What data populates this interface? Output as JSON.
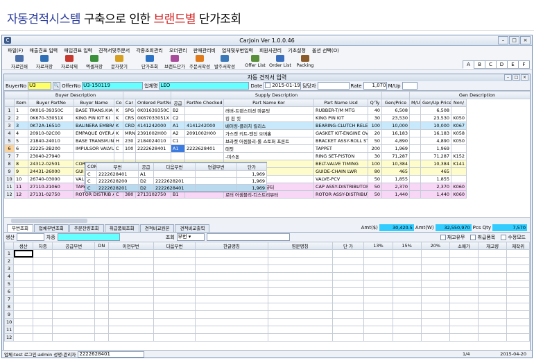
{
  "header": {
    "part1": "자동견적시스템",
    "part2": " 구축으로 인한 ",
    "part3": "브랜드별",
    "part4": " 단가조회"
  },
  "window": {
    "title": "CarJoin Ver 1.0.0.46"
  },
  "menu": [
    "파일(F)",
    "매출견표 입력",
    "매입견표 입력",
    "견적서및주문서",
    "각종조회관리",
    "오더관리",
    "판매관리비",
    "업체및부번입력",
    "회원사관리",
    "기초설정",
    "옵션 선택(O)"
  ],
  "toolbar": [
    "자료인쇄",
    "자료저장",
    "자료삭제",
    "엑셀저장",
    "문자찾기",
    "단가조회",
    "브랜드단가",
    "주문서작성",
    "발주서작성",
    "Offer List",
    "Order List",
    "Packing"
  ],
  "alpha_tabs": [
    "A",
    "B",
    "C",
    "D",
    "E",
    "F"
  ],
  "subwindow": {
    "title": "자동 견적서 입력"
  },
  "form": {
    "buyerno_label": "BuyerNo",
    "buyerno": "U3",
    "offerno_label": "OfferNo",
    "offerno": "U3-150119",
    "company_label": "업체명",
    "company": "LEO",
    "date_label": "Date",
    "date": "2015-01-19",
    "manager_label": "담당자",
    "rate_label": "Rate",
    "rate": "1,070",
    "unit": "M/Up"
  },
  "grid1": {
    "group_headers": {
      "buyer": "Buyer Description",
      "supply": "Supply Description",
      "gen": "Gen Description"
    },
    "columns": [
      "Item",
      "Buyer PartNo",
      "Buyer Name",
      "Co",
      "Car",
      "Ordered PartNo",
      "공급",
      "PartNo Checked",
      "Part Name Kor",
      "Part Name Usd",
      "Q'Ty",
      "Gen/Price",
      "M/Up",
      "Gen/Up Price",
      "Non/"
    ],
    "rows": [
      [
        "1",
        "1",
        "0K016-39350C",
        "BASE TRANS.KIA",
        "K",
        "SPG",
        "0K01639350C",
        "B2",
        "",
        "러버-트랜스미션 마운팅",
        "RUBBER-T/M MTG",
        "40",
        "6,508",
        "",
        "6,508",
        ""
      ],
      [
        "2",
        "2",
        "0K670-33051X",
        "KING PIN KIT KI",
        "K",
        "CRS",
        "0K67033051X",
        "C2",
        "",
        "킹 핀 킷",
        "KING PIN KIT",
        "30",
        "23,530",
        "",
        "23,530",
        "K050"
      ],
      [
        "3",
        "3",
        "0K72A-16510",
        "BALINERA EMBRAG",
        "K",
        "CRD",
        "4141242000",
        "A1",
        "4141242000",
        "베어링-클러치 릴리스",
        "BEARING-CLUTCH RELEASE",
        "100",
        "10,000",
        "",
        "10,000",
        "K067"
      ],
      [
        "4",
        "4",
        "20910-02C00",
        "EMPAQUE OYER.AT",
        "K",
        "MRN",
        "2391002H00",
        "A2",
        "2091002H00",
        "가스켓 키트-엔진 오버홀",
        "GASKET KIT-ENGINE OVERH",
        "20",
        "16,183",
        "",
        "16,183",
        "K058"
      ],
      [
        "5",
        "5",
        "21840-24010",
        "BASE TRANSM.INF",
        "H",
        "230",
        "2184024010",
        "C1",
        "",
        "브라켓 어셈블리-롤 스토퍼 프론트",
        "BRACKET ASSY-ROLL STOPP",
        "50",
        "4,890",
        "",
        "4,890",
        "K050"
      ],
      [
        "6",
        "6",
        "22225-2B200",
        "IMPULSOR VALVUL",
        "C",
        "100",
        "2222628401",
        "A1",
        "2222628401",
        "태핏",
        "TAPPET",
        "200",
        "1,969",
        "",
        "1,969",
        ""
      ],
      [
        "7",
        "7",
        "23040-27940",
        "",
        "",
        "",
        "",
        "",
        "",
        "-피스톤",
        "RING SET-PISTON",
        "30",
        "71,287",
        "",
        "71,287",
        "K152"
      ],
      [
        "8",
        "8",
        "24312-02501",
        "COR",
        "",
        "",
        "",
        "",
        "",
        "벨트-밸브 타이밍",
        "BELT-VALVE TIMING",
        "100",
        "10,384",
        "",
        "10,384",
        "K141"
      ],
      [
        "9",
        "9",
        "24431-26000",
        "GUI",
        "",
        "",
        "",
        "",
        "",
        "-체인 하부",
        "GUIDE-CHAIN LWR",
        "80",
        "465",
        "",
        "465",
        ""
      ],
      [
        "10",
        "10",
        "26740-03000",
        "VAL",
        "",
        "",
        "",
        "",
        "",
        "PCV",
        "VALVE-PCV",
        "50",
        "1,855",
        "",
        "1,855",
        ""
      ],
      [
        "11",
        "11",
        "27110-21060",
        "TAPA DISTRIB.E",
        "C",
        "370",
        "2711021060",
        "B1",
        "",
        "캡 어셈블리-디스트리뷰터",
        "CAP ASSY-DISTRIBUTOR",
        "50",
        "2,370",
        "",
        "2,370",
        "K060"
      ],
      [
        "12",
        "12",
        "27131-02750",
        "ROTOR DISTRIB A",
        "C",
        "380",
        "2713102750",
        "B1",
        "",
        "로터 어셈블리-디스트리뷰터",
        "ROTOR ASSY-DISTRIBUTOR",
        "50",
        "1,440",
        "",
        "1,440",
        "K060"
      ]
    ]
  },
  "popup": {
    "columns": [
      "COMP",
      "부번",
      "공급",
      "다음부번",
      "연결부번",
      "단가"
    ],
    "rows": [
      [
        "C",
        "2222628401",
        "A1",
        "",
        "",
        "1,969"
      ],
      [
        "C",
        "2222628200",
        "D2",
        "2222628201",
        "",
        "1,969"
      ],
      [
        "C",
        "2222628201",
        "D2",
        "2222628401",
        "",
        "1,969"
      ]
    ]
  },
  "tabs2": [
    "부번조회",
    "업체부번조회",
    "주문잔량조회",
    "취급품목조회",
    "견적비교원본",
    "견적비교출력"
  ],
  "amounts": {
    "amt_label": "Amt($)",
    "amt": "30,420.5",
    "amtw_label": "Amt(W)",
    "amtw": "32,550,970",
    "pcs_label": "Pcs Qty",
    "pcs": "7,570"
  },
  "filter2": {
    "f1": "생산",
    "f2": "차종",
    "f3": "조회",
    "f4": "부번",
    "c1": "재고유무",
    "c2": "취급품목",
    "c3": "수정모드"
  },
  "grid2": {
    "columns": [
      "생산",
      "차종",
      "공급부번",
      "DN",
      "이전부번",
      "다음부번",
      "한글명칭",
      "영문명칭",
      "단 가",
      "13%",
      "15%",
      "20%",
      "소매가",
      "재고량",
      "제작위"
    ],
    "rows": [
      "1",
      "2",
      "3",
      "4",
      "5",
      "6",
      "7",
      "8",
      "9",
      "10",
      "11",
      "12"
    ]
  },
  "status": {
    "left": "업체:test 로그인:admin 성명:관리자",
    "input": "2222628401",
    "page": "1/4",
    "date": "2015-04-20"
  }
}
